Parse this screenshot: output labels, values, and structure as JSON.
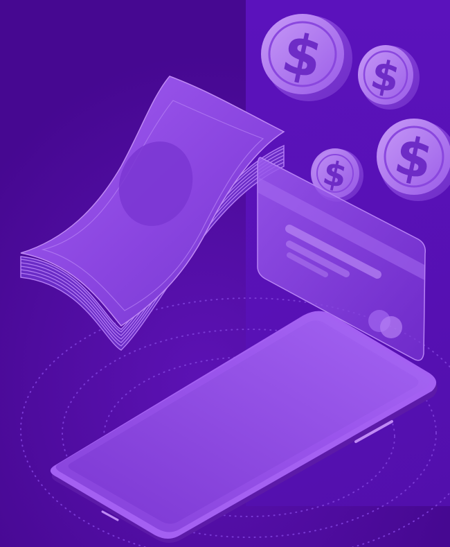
{
  "illustration": {
    "subject": "money-transfer-illustration",
    "colors": {
      "background": "#4a0a96",
      "panel": "#5a12b8",
      "accent": "#8f4ae6",
      "highlight": "#c08af5"
    },
    "icons": [
      "dollar-coin-icon",
      "banknote-stack-icon",
      "credit-card-icon",
      "smartphone-icon"
    ],
    "coin_symbol": "$"
  }
}
